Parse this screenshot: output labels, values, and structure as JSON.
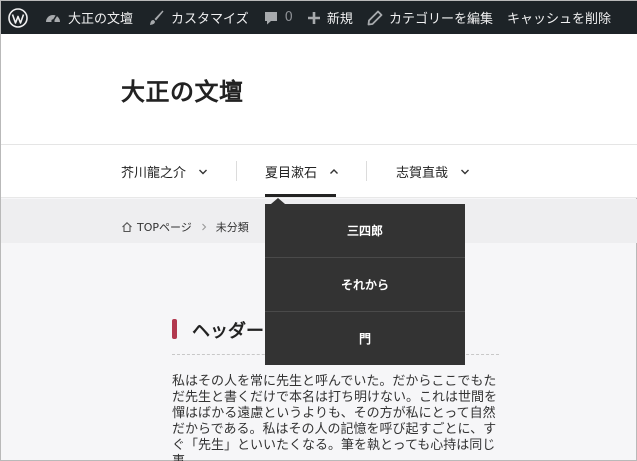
{
  "admin_bar": {
    "site_name": "大正の文壇",
    "customize": "カスタマイズ",
    "comments_count": "0",
    "new": "新規",
    "edit_category": "カテゴリーを編集",
    "clear_cache": "キャッシュを削除"
  },
  "site": {
    "title": "大正の文壇"
  },
  "nav": {
    "items": [
      {
        "label": "芥川龍之介"
      },
      {
        "label": "夏目漱石"
      },
      {
        "label": "志賀直哉"
      }
    ],
    "dropdown": [
      "三四郎",
      "それから",
      "門"
    ]
  },
  "breadcrumb": {
    "home": "TOPページ",
    "category": "未分類"
  },
  "content": {
    "heading": "ヘッダー",
    "body": "私はその人を常に先生と呼んでいた。だからここでもただ先生と書くだけで本名は打ち明けない。これは世間を憚はばかる遠慮というよりも、その方が私にとって自然だからである。私はその人の記憶を呼び起すごとに、すぐ「先生」といいたくなる。筆を執とっても心持は同じ事"
  },
  "colors": {
    "admin_bg": "#1d2327",
    "dropdown_bg": "#333333",
    "heading_accent": "#b2384e"
  }
}
